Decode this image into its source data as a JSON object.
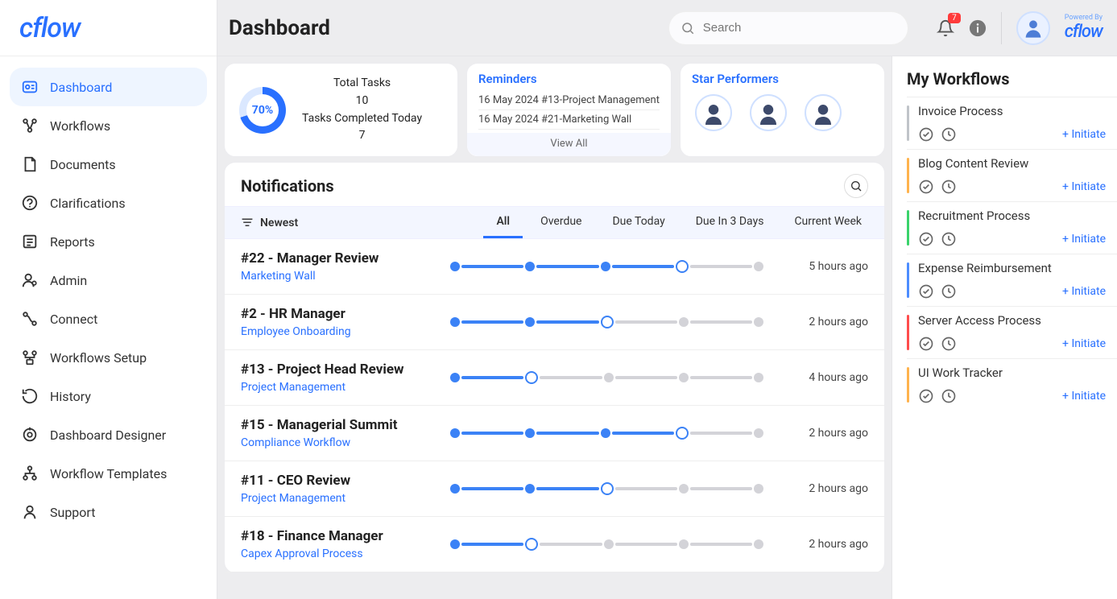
{
  "header": {
    "title": "Dashboard",
    "search_placeholder": "Search",
    "notif_count": "7",
    "powered_by": "Powered By"
  },
  "sidebar": {
    "items": [
      {
        "label": "Dashboard"
      },
      {
        "label": "Workflows"
      },
      {
        "label": "Documents"
      },
      {
        "label": "Clarifications"
      },
      {
        "label": "Reports"
      },
      {
        "label": "Admin"
      },
      {
        "label": "Connect"
      },
      {
        "label": "Workflows Setup"
      },
      {
        "label": "History"
      },
      {
        "label": "Dashboard Designer"
      },
      {
        "label": "Workflow Templates"
      },
      {
        "label": "Support"
      }
    ]
  },
  "tasks": {
    "percent": "70%",
    "total_label": "Total Tasks",
    "total_value": "10",
    "completed_label": "Tasks Completed Today",
    "completed_value": "7"
  },
  "reminders": {
    "title": "Reminders",
    "items": [
      "16 May 2024 #13-Project Management",
      "16 May 2024 #21-Marketing Wall"
    ],
    "view_all": "View All"
  },
  "performers": {
    "title": "Star Performers"
  },
  "notifications": {
    "title": "Notifications",
    "sort_label": "Newest",
    "tabs": [
      "All",
      "Overdue",
      "Due Today",
      "Due In 3 Days",
      "Current Week"
    ],
    "active_tab": 0,
    "rows": [
      {
        "title": "#22 - Manager Review",
        "sub": "Marketing Wall",
        "time": "5 hours ago",
        "progress": 3,
        "active": 3
      },
      {
        "title": "#2 - HR Manager",
        "sub": "Employee Onboarding",
        "time": "2 hours ago",
        "progress": 2,
        "active": 2
      },
      {
        "title": "#13 - Project Head Review",
        "sub": "Project Management",
        "time": "4 hours ago",
        "progress": 1,
        "active": 1
      },
      {
        "title": "#15 - Managerial Summit",
        "sub": "Compliance Workflow",
        "time": "2 hours ago",
        "progress": 3,
        "active": 3
      },
      {
        "title": "#11 - CEO Review",
        "sub": "Project Management",
        "time": "2 hours ago",
        "progress": 2,
        "active": 2
      },
      {
        "title": "#18 - Finance Manager",
        "sub": "Capex Approval Process",
        "time": "2 hours ago",
        "progress": 1,
        "active": 1
      }
    ]
  },
  "my_workflows": {
    "title": "My Workflows",
    "initiate_label": "+ Initiate",
    "items": [
      {
        "name": "Invoice Process",
        "color": "#c0c4c9"
      },
      {
        "name": "Blog Content Review",
        "color": "#ffb34d"
      },
      {
        "name": "Recruitment Process",
        "color": "#3ad36b"
      },
      {
        "name": "Expense Reimbursement",
        "color": "#4d8dff"
      },
      {
        "name": "Server Access Process",
        "color": "#ff4d4d"
      },
      {
        "name": "UI Work Tracker",
        "color": "#ffb34d"
      }
    ]
  },
  "brand": {
    "name": "cflow"
  }
}
